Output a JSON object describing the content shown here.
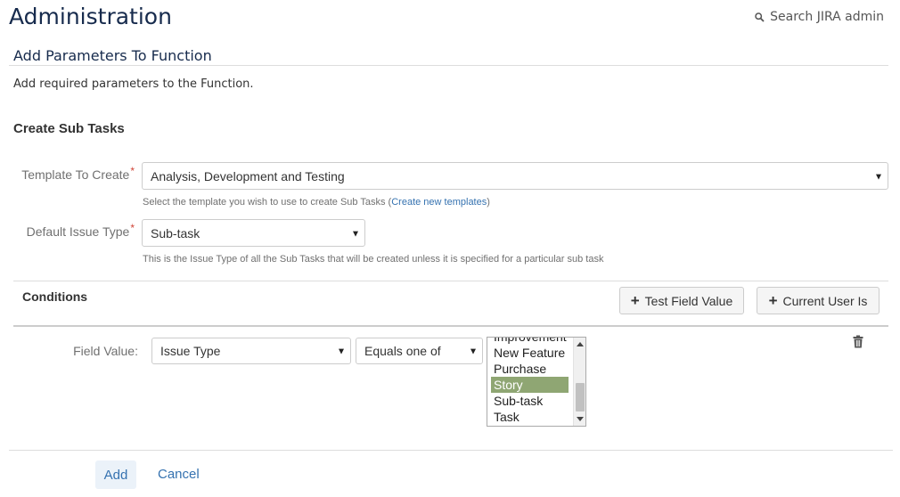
{
  "header": {
    "title": "Administration",
    "search_label": "Search JIRA admin"
  },
  "section": {
    "title": "Add Parameters To Function",
    "description": "Add required parameters to the Function."
  },
  "form": {
    "heading": "Create Sub Tasks",
    "template": {
      "label": "Template To Create",
      "required_mark": "*",
      "value": "Analysis, Development and Testing",
      "help_prefix": "Select the template you wish to use to create Sub Tasks (",
      "help_link": "Create new templates",
      "help_suffix": ")"
    },
    "issue_type": {
      "label": "Default Issue Type",
      "required_mark": "*",
      "value": "Sub-task",
      "help": "This is the Issue Type of all the Sub Tasks that will be created unless it is specified for a particular sub task"
    }
  },
  "conditions": {
    "heading": "Conditions",
    "buttons": {
      "test_field_value": "Test Field Value",
      "current_user_is": "Current User Is"
    },
    "row": {
      "label": "Field Value:",
      "field": "Issue Type",
      "operator": "Equals one of",
      "options": [
        "Improvement",
        "New Feature",
        "Purchase",
        "Story",
        "Sub-task",
        "Task"
      ],
      "selected": "Story"
    }
  },
  "footer": {
    "add_label": "Add",
    "cancel_label": "Cancel"
  },
  "colors": {
    "link": "#3572b0",
    "selected_option": "#8fa673",
    "required": "#d04437",
    "title": "#172b4d"
  },
  "icons": [
    "search-icon",
    "plus-icon",
    "trash-icon",
    "chevron-down-icon"
  ]
}
